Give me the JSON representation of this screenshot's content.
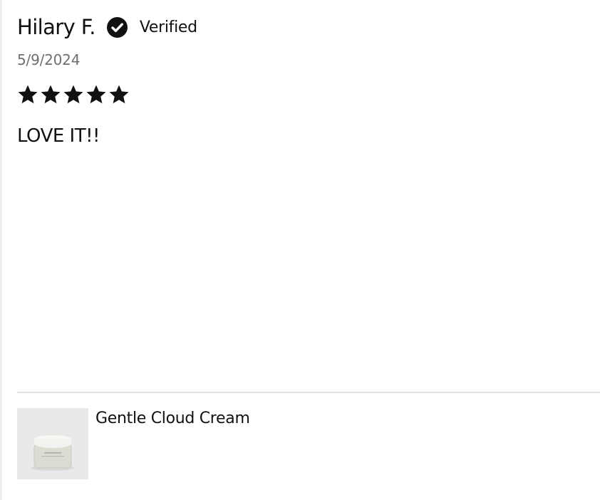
{
  "review": {
    "reviewer_name": "Hilary F.",
    "verified_label": "Verified",
    "date": "5/9/2024",
    "rating": 5,
    "rating_max": 5,
    "body": "LOVE IT!!"
  },
  "product": {
    "name": "Gentle Cloud Cream"
  },
  "icons": {
    "verified": "check-circle-icon",
    "star": "star-icon"
  },
  "colors": {
    "text": "#111111",
    "date": "#6f6f6f",
    "divider": "#e3e3e3",
    "thumb_background": "#e9e9e9"
  }
}
